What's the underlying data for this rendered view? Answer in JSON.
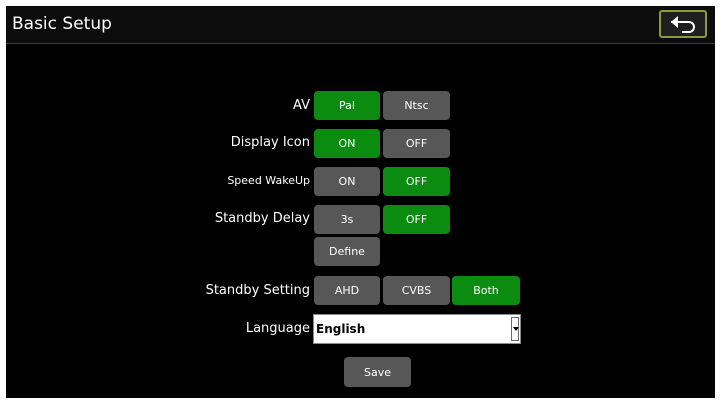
{
  "header": {
    "title": "Basic Setup",
    "back_icon": "back-arrow-icon"
  },
  "rows": {
    "av": {
      "label": "AV",
      "options": [
        "Pal",
        "Ntsc"
      ],
      "selected": "Pal"
    },
    "display_icon": {
      "label": "Display Icon",
      "options": [
        "ON",
        "OFF"
      ],
      "selected": "ON"
    },
    "speed_wakeup": {
      "label": "Speed WakeUp",
      "options": [
        "ON",
        "OFF"
      ],
      "selected": "OFF"
    },
    "standby_delay": {
      "label": "Standby Delay",
      "options": [
        "3s",
        "OFF"
      ],
      "selected": "OFF",
      "define_label": "Define"
    },
    "standby_setting": {
      "label": "Standby Setting",
      "options": [
        "AHD",
        "CVBS",
        "Both"
      ],
      "selected": "Both"
    },
    "language": {
      "label": "Language",
      "value": "English"
    }
  },
  "save_label": "Save",
  "colors": {
    "selected": "#0b8c11",
    "unselected": "#575757",
    "back_border": "#8a9a3c",
    "background": "#000000"
  }
}
